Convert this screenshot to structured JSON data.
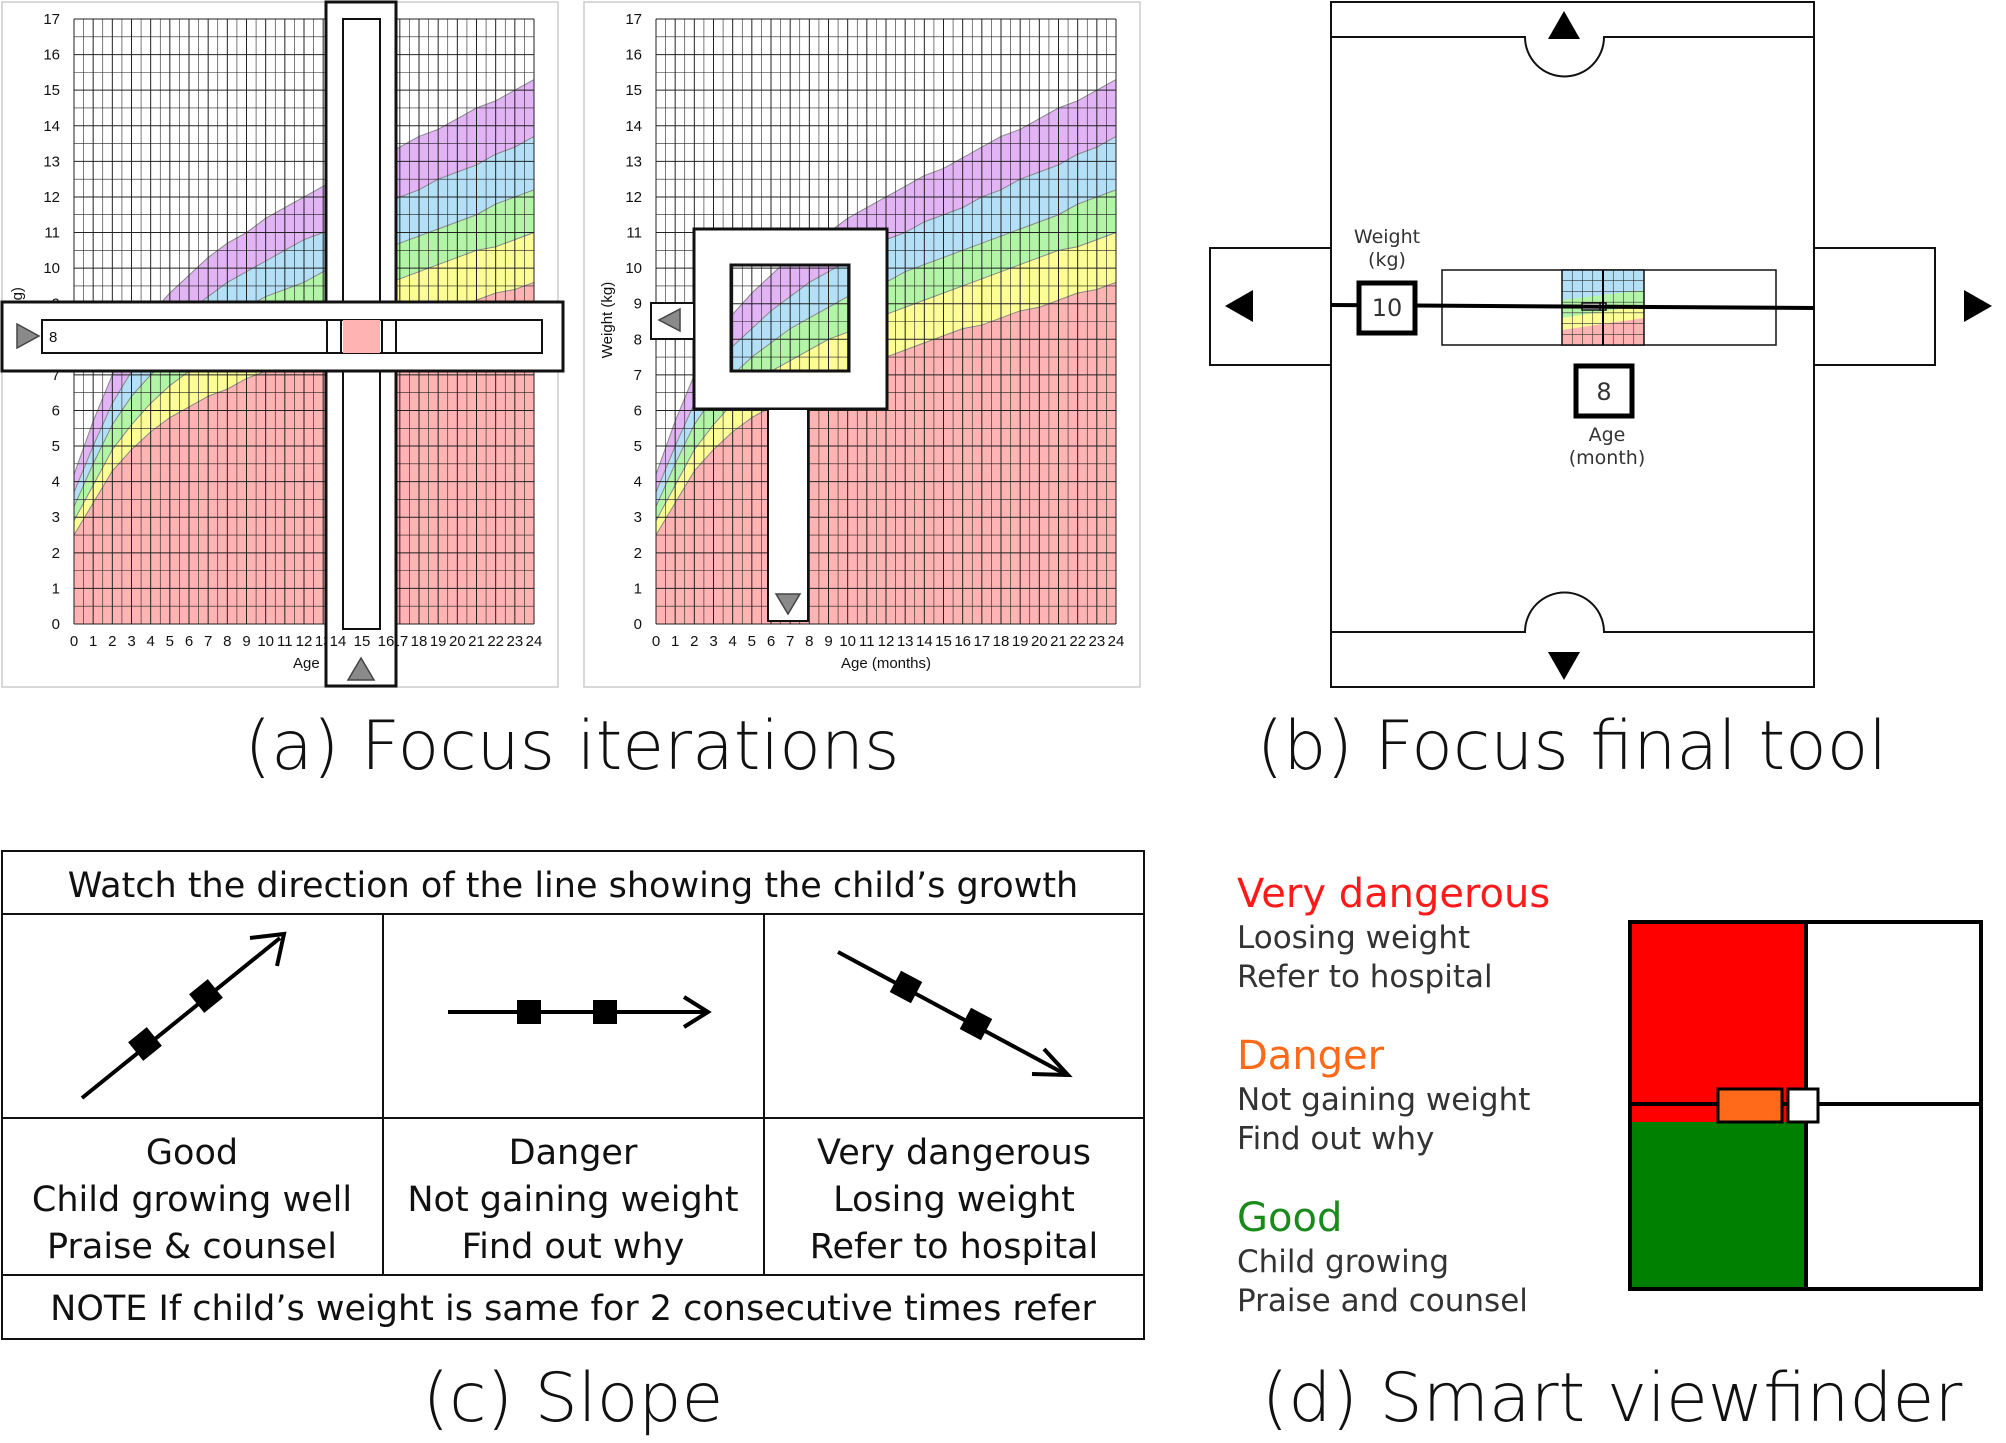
{
  "panel_a": {
    "caption": "(a) Focus iterations",
    "y_ticks": [
      "0",
      "1",
      "2",
      "3",
      "4",
      "5",
      "6",
      "7",
      "8",
      "9",
      "10",
      "11",
      "12",
      "13",
      "14",
      "15",
      "16",
      "17"
    ],
    "x_ticks": [
      "0",
      "1",
      "2",
      "3",
      "4",
      "5",
      "6",
      "7",
      "8",
      "9",
      "10",
      "11",
      "12",
      "13",
      "14",
      "15",
      "16",
      "17",
      "18",
      "19",
      "20",
      "21",
      "22",
      "23",
      "24"
    ],
    "xlabel_clipped": "Age (mon",
    "xlabel": "Age (months)",
    "ylabel_clipped": "(kg)",
    "ylabel": "Weight (kg)",
    "left_focus": {
      "weight_value": "8",
      "age_value": "15"
    }
  },
  "panel_b": {
    "caption": "(b) Focus final tool",
    "weight_label_1": "Weight",
    "weight_label_2": "(kg)",
    "weight_value": "10",
    "age_value": "8",
    "age_label_1": "Age",
    "age_label_2": "(month)"
  },
  "panel_c": {
    "caption": "(c) Slope",
    "header": "Watch the direction of the line showing the child’s growth",
    "columns": [
      {
        "lines": [
          "Good",
          "Child growing well",
          "Praise & counsel"
        ]
      },
      {
        "lines": [
          "Danger",
          "Not gaining weight",
          "Find out why"
        ]
      },
      {
        "lines": [
          "Very dangerous",
          "Losing weight",
          "Refer to hospital"
        ]
      }
    ],
    "note": "NOTE If child’s weight is same for 2 consecutive times refer"
  },
  "panel_d": {
    "caption": "(d) Smart viewfinder",
    "legend": [
      {
        "title": "Very dangerous",
        "color": "#ff1a1a",
        "lines": [
          "Loosing weight",
          "Refer to hospital"
        ]
      },
      {
        "title": "Danger",
        "color": "#ff6a1a",
        "lines": [
          "Not gaining weight",
          "Find out why"
        ]
      },
      {
        "title": "Good",
        "color": "#1a8a1a",
        "lines": [
          "Child growing",
          "Praise and counsel"
        ]
      }
    ]
  },
  "chart_data": {
    "type": "area",
    "x": [
      0,
      1,
      2,
      3,
      4,
      5,
      6,
      7,
      8,
      9,
      10,
      11,
      12,
      13,
      14,
      15,
      16,
      17,
      18,
      19,
      20,
      21,
      22,
      23,
      24
    ],
    "xlim": [
      0,
      24
    ],
    "ylim": [
      0,
      17
    ],
    "bands": [
      {
        "color": "#ffb3b3",
        "upper": [
          2.5,
          3.4,
          4.3,
          4.9,
          5.4,
          5.8,
          6.1,
          6.4,
          6.6,
          6.9,
          7.1,
          7.3,
          7.5,
          7.7,
          7.9,
          8.1,
          8.3,
          8.4,
          8.6,
          8.8,
          8.9,
          9.1,
          9.3,
          9.4,
          9.6
        ]
      },
      {
        "color": "#fdfd96",
        "upper": [
          2.9,
          3.9,
          4.9,
          5.6,
          6.2,
          6.7,
          7.1,
          7.4,
          7.7,
          8.0,
          8.2,
          8.5,
          8.7,
          8.9,
          9.1,
          9.3,
          9.5,
          9.7,
          9.9,
          10.1,
          10.3,
          10.5,
          10.6,
          10.8,
          11.0
        ]
      },
      {
        "color": "#b3f5a6",
        "upper": [
          3.3,
          4.5,
          5.6,
          6.4,
          7.0,
          7.5,
          7.9,
          8.3,
          8.6,
          8.9,
          9.2,
          9.4,
          9.6,
          9.9,
          10.1,
          10.3,
          10.5,
          10.7,
          10.9,
          11.1,
          11.3,
          11.5,
          11.8,
          12.0,
          12.2
        ]
      },
      {
        "color": "#b3e0f7",
        "upper": [
          3.7,
          5.0,
          6.2,
          7.1,
          7.8,
          8.3,
          8.8,
          9.2,
          9.6,
          9.9,
          10.2,
          10.5,
          10.8,
          11.0,
          11.3,
          11.5,
          11.7,
          12.0,
          12.2,
          12.5,
          12.7,
          12.9,
          13.2,
          13.4,
          13.7
        ]
      },
      {
        "color": "#e2b3f5",
        "upper": [
          4.2,
          5.7,
          7.0,
          8.0,
          8.7,
          9.3,
          9.8,
          10.3,
          10.7,
          11.0,
          11.4,
          11.7,
          12.0,
          12.3,
          12.6,
          12.8,
          13.1,
          13.4,
          13.7,
          13.9,
          14.2,
          14.5,
          14.7,
          15.0,
          15.3
        ]
      }
    ]
  }
}
